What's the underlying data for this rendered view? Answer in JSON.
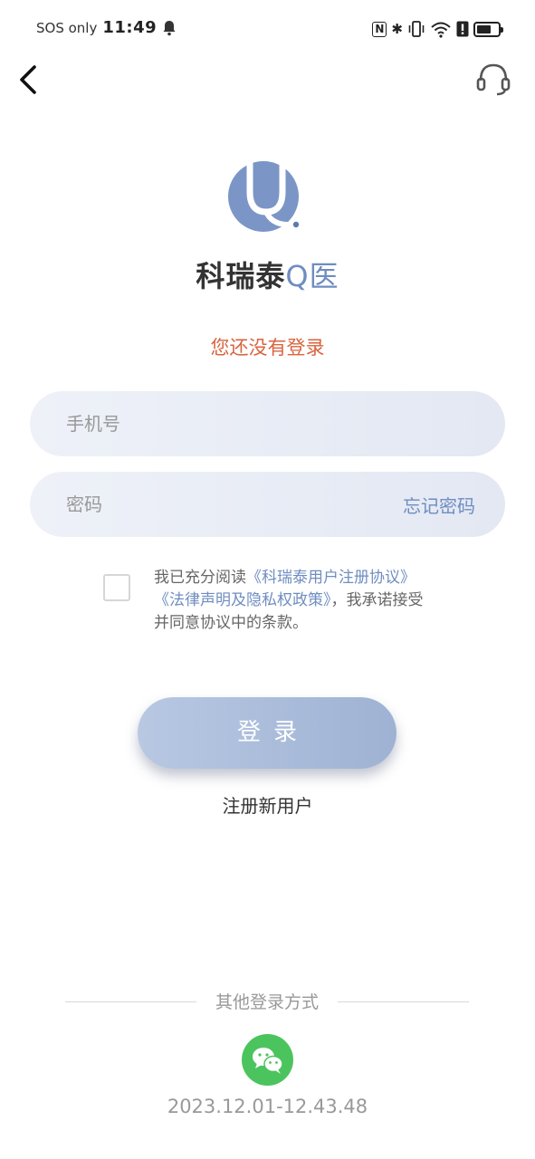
{
  "status_bar": {
    "carrier": "SOS only",
    "time": "11:49",
    "nfc": "N",
    "bt": "✱",
    "battery_level": 0.7
  },
  "header": {
    "back_icon": "chevron-left-icon",
    "service_icon": "headset-icon"
  },
  "brand": {
    "name_main": "科瑞泰",
    "name_q": "Q医",
    "logo_color": "#7b96c6"
  },
  "login_hint": "您还没有登录",
  "form": {
    "phone_placeholder": "手机号",
    "password_placeholder": "密码",
    "forgot_label": "忘记密码"
  },
  "agreement": {
    "prefix": "我已充分阅读",
    "link1": "《科瑞泰用户注册协议》",
    "link2": "《法律声明及隐私权政策》",
    "suffix": "，我承诺接受并同意协议中的条款。",
    "checked": false
  },
  "login_button": "登录",
  "register_link": "注册新用户",
  "other_login": {
    "label": "其他登录方式",
    "wechat_icon": "wechat-icon",
    "wechat_color": "#4cc45e"
  },
  "version": "2023.12.01-12.43.48"
}
